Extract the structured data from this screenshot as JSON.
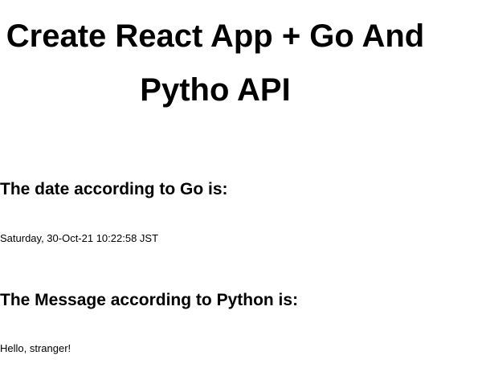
{
  "header": {
    "title": "Create React App + Go And Pytho API"
  },
  "go_section": {
    "heading": "The date according to Go is:",
    "value": "Saturday, 30-Oct-21 10:22:58 JST"
  },
  "python_section": {
    "heading": "The Message according to Python is:",
    "value": "Hello, stranger!"
  }
}
